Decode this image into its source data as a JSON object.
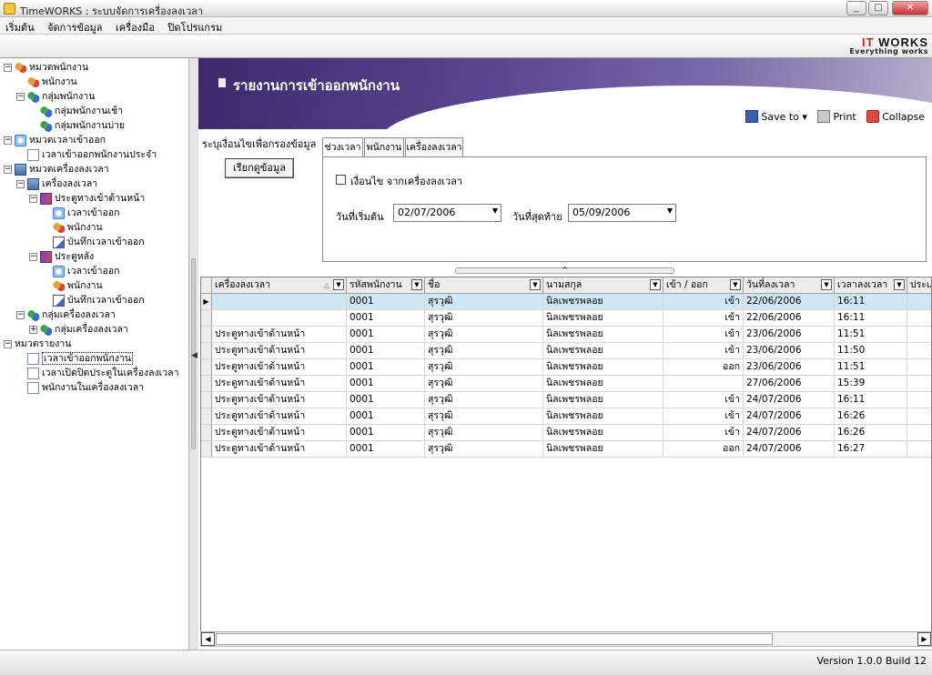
{
  "window": {
    "title": "TimeWORKS : ระบบจัดการเครื่องลงเวลา"
  },
  "menu": [
    "เริ่มต้น",
    "จัดการข้อมูล",
    "เครื่องมือ",
    "ปิดโปรแกรม"
  ],
  "brand": {
    "logo_it": "IT",
    "logo_works": "WORKS",
    "tagline": "Everything works"
  },
  "tree": [
    {
      "label": "หมวดพนักงาน",
      "icon": "people-icon",
      "exp": "−"
    },
    {
      "label": "พนักงาน",
      "icon": "people-icon",
      "exp": ""
    },
    {
      "label": "กลุ่มพนักงาน",
      "icon": "group-icon",
      "exp": "−"
    },
    {
      "label": "กลุ่มพนักงานเช้า",
      "icon": "group-icon",
      "exp": ""
    },
    {
      "label": "กลุ่มพนักงานบ่าย",
      "icon": "group-icon",
      "exp": ""
    },
    {
      "label": "หมวดเวลาเข้าออก",
      "icon": "clock-icon",
      "exp": "−"
    },
    {
      "label": "เวลาเข้าออกพนักงานประจำ",
      "icon": "document-icon",
      "exp": ""
    },
    {
      "label": "หมวดเครื่องลงเวลา",
      "icon": "machine-icon",
      "exp": "−"
    },
    {
      "label": "เครื่องลงเวลา",
      "icon": "machine-icon",
      "exp": "−"
    },
    {
      "label": "ประตูทางเข้าด้านหน้า",
      "icon": "door-icon",
      "exp": "−"
    },
    {
      "label": "เวลาเข้าออก",
      "icon": "clock-icon",
      "exp": ""
    },
    {
      "label": "พนักงาน",
      "icon": "people-icon",
      "exp": ""
    },
    {
      "label": "บันทึกเวลาเข้าออก",
      "icon": "edit-icon",
      "exp": ""
    },
    {
      "label": "ประตูหลัง",
      "icon": "door-icon",
      "exp": "−"
    },
    {
      "label": "เวลาเข้าออก",
      "icon": "clock-icon",
      "exp": ""
    },
    {
      "label": "พนักงาน",
      "icon": "people-icon",
      "exp": ""
    },
    {
      "label": "บันทึกเวลาเข้าออก",
      "icon": "edit-icon",
      "exp": ""
    },
    {
      "label": "กลุ่มเครื่องลงเวลา",
      "icon": "group-icon",
      "exp": "−"
    },
    {
      "label": "กลุ่มเครื่องลงเวลา",
      "icon": "group-icon",
      "exp": "+"
    },
    {
      "label": "หมวดรายงาน",
      "icon": "report-icon",
      "exp": "−"
    },
    {
      "label": "เวลาเข้าออกพนักงาน",
      "icon": "document-icon",
      "exp": "",
      "selected": true
    },
    {
      "label": "เวลาเปิดปิดประตูในเครื่องลงเวลา",
      "icon": "document-icon",
      "exp": ""
    },
    {
      "label": "พนักงานในเครื่องลงเวลา",
      "icon": "document-icon",
      "exp": ""
    }
  ],
  "report": {
    "title": "รายงานการเข้าออกพนักงาน",
    "toolbar": {
      "save": "Save to",
      "print": "Print",
      "collapse": "Collapse"
    },
    "filter_label": "ระบุเงื่อนไขเพื่อกรองข้อมูล",
    "fetch_button": "เรียกดูข้อมูล",
    "tabs": [
      "ช่วงเวลา",
      "พนักงาน",
      "เครื่องลงเวลา"
    ],
    "condition_label": "เงื่อนไข จากเครื่องลงเวลา",
    "start_label": "วันที่เริ่มต้น",
    "start_value": "02/07/2006",
    "end_label": "วันที่สุดท้าย",
    "end_value": "05/09/2006"
  },
  "grid": {
    "columns": [
      "เครื่องลงเวลา",
      "รหัสพนักงาน",
      "ชื่อ",
      "นามสกุล",
      "เข้า / ออก",
      "วันที่ลงเวลา",
      "เวลาลงเวลา",
      "ประเภ"
    ],
    "rows": [
      [
        "",
        "0001",
        "สุรวุฒิ",
        "นิลเพชรพลอย",
        "เข้า",
        "22/06/2006",
        "16:11"
      ],
      [
        "",
        "0001",
        "สุรวุฒิ",
        "นิลเพชรพลอย",
        "เข้า",
        "22/06/2006",
        "16:11"
      ],
      [
        "ประตูทางเข้าด้านหน้า",
        "0001",
        "สุรวุฒิ",
        "นิลเพชรพลอย",
        "เข้า",
        "23/06/2006",
        "11:51"
      ],
      [
        "ประตูทางเข้าด้านหน้า",
        "0001",
        "สุรวุฒิ",
        "นิลเพชรพลอย",
        "เข้า",
        "23/06/2006",
        "11:50"
      ],
      [
        "ประตูทางเข้าด้านหน้า",
        "0001",
        "สุรวุฒิ",
        "นิลเพชรพลอย",
        "ออก",
        "23/06/2006",
        "11:51"
      ],
      [
        "ประตูทางเข้าด้านหน้า",
        "0001",
        "สุรวุฒิ",
        "นิลเพชรพลอย",
        "",
        "27/06/2006",
        "15:39"
      ],
      [
        "ประตูทางเข้าด้านหน้า",
        "0001",
        "สุรวุฒิ",
        "นิลเพชรพลอย",
        "เข้า",
        "24/07/2006",
        "16:11"
      ],
      [
        "ประตูทางเข้าด้านหน้า",
        "0001",
        "สุรวุฒิ",
        "นิลเพชรพลอย",
        "เข้า",
        "24/07/2006",
        "16:26"
      ],
      [
        "ประตูทางเข้าด้านหน้า",
        "0001",
        "สุรวุฒิ",
        "นิลเพชรพลอย",
        "เข้า",
        "24/07/2006",
        "16:26"
      ],
      [
        "ประตูทางเข้าด้านหน้า",
        "0001",
        "สุรวุฒิ",
        "นิลเพชรพลอย",
        "ออก",
        "24/07/2006",
        "16:27"
      ]
    ]
  },
  "status": {
    "version": "Version 1.0.0 Build 12"
  }
}
